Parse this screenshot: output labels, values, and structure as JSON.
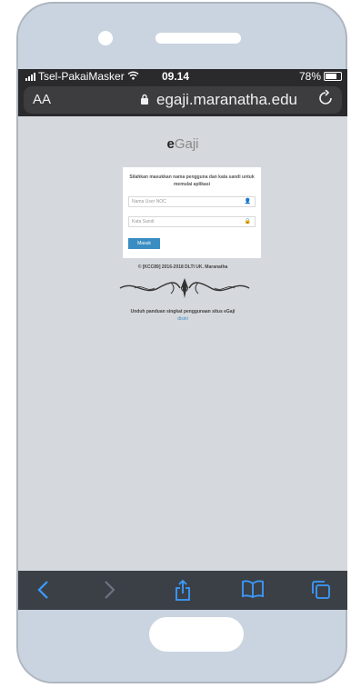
{
  "status_bar": {
    "carrier": "Tsel-PakaiMasker",
    "time": "09.14",
    "battery": "78%",
    "battery_level": 0.78
  },
  "browser": {
    "text_size_label": "AA",
    "url": "egaji.maranatha.edu"
  },
  "page": {
    "brand_bold": "e",
    "brand_rest": "Gaji",
    "instruction": "Silahkan masukkan nama pengguna dan kata sandi untuk memulai aplikasi",
    "username_placeholder": "Nama User NOC",
    "password_placeholder": "Kata Sandi",
    "login_button": "Masuk",
    "copyright": "© [KCC89] 2016-2018 DLTI UK. Maranatha",
    "guide_text": "Unduh panduan singkat penggunaan situs eGaji",
    "guide_link": "disini"
  },
  "toolbar": {
    "icons": [
      "back-icon",
      "forward-icon",
      "share-icon",
      "bookmarks-icon",
      "tabs-icon"
    ],
    "accent": "#3a9cff"
  }
}
